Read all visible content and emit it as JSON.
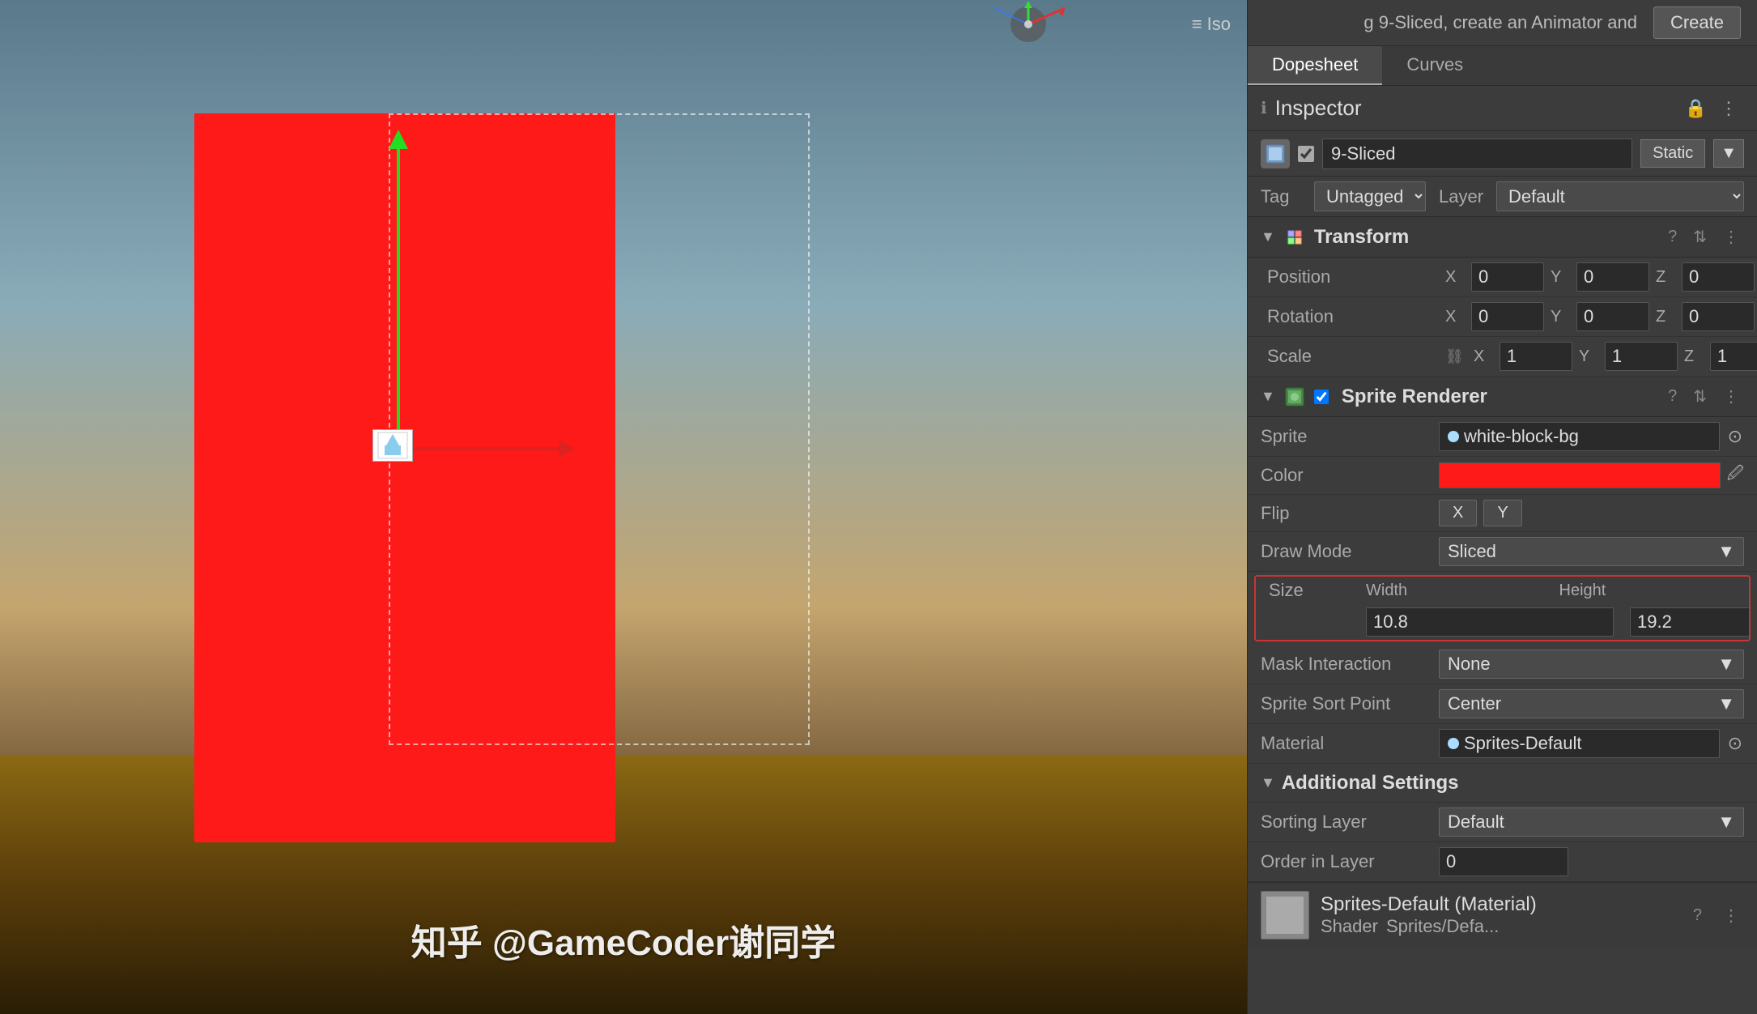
{
  "scene": {
    "iso_label": "Iso",
    "watermark": "知乎 @GameCoder谢同学"
  },
  "top_banner": {
    "message": "g 9-Sliced, create an Animator and",
    "create_btn": "Create"
  },
  "tabs": {
    "dopesheet": "Dopesheet",
    "curves": "Curves"
  },
  "inspector": {
    "title": "Inspector",
    "lock_icon": "🔒",
    "kebab_icon": "⋮"
  },
  "object": {
    "name": "9-Sliced",
    "static_btn": "Static",
    "tag_label": "Tag",
    "tag_value": "Untagged",
    "layer_label": "Layer",
    "layer_value": "Default"
  },
  "transform": {
    "title": "Transform",
    "position_label": "Position",
    "rotation_label": "Rotation",
    "scale_label": "Scale",
    "x": "X",
    "y": "Y",
    "z": "Z",
    "pos_x": "0",
    "pos_y": "0",
    "pos_z": "0",
    "rot_x": "0",
    "rot_y": "0",
    "rot_z": "0",
    "scale_x": "1",
    "scale_y": "1",
    "scale_z": "1"
  },
  "sprite_renderer": {
    "title": "Sprite Renderer",
    "sprite_label": "Sprite",
    "sprite_value": "white-block-bg",
    "color_label": "Color",
    "flip_label": "Flip",
    "flip_x": "X",
    "flip_y": "Y",
    "draw_mode_label": "Draw Mode",
    "draw_mode_value": "Sliced",
    "size_label": "Size",
    "width_label": "Width",
    "height_label": "Height",
    "width_value": "10.8",
    "height_value": "19.2",
    "mask_interaction_label": "Mask Interaction",
    "mask_interaction_value": "None",
    "sprite_sort_point_label": "Sprite Sort Point",
    "sprite_sort_point_value": "Center",
    "material_label": "Material",
    "material_value": "Sprites-Default"
  },
  "additional_settings": {
    "title": "Additional Settings",
    "sorting_layer_label": "Sorting Layer",
    "sorting_layer_value": "Default",
    "order_in_layer_label": "Order in Layer",
    "order_in_layer_value": "0"
  },
  "material_bottom": {
    "name": "Sprites-Default (Material)",
    "shader_label": "Shader",
    "question_icon": "?",
    "kebab_icon": "⋮",
    "shader_value": "Sprites/Defa..."
  }
}
